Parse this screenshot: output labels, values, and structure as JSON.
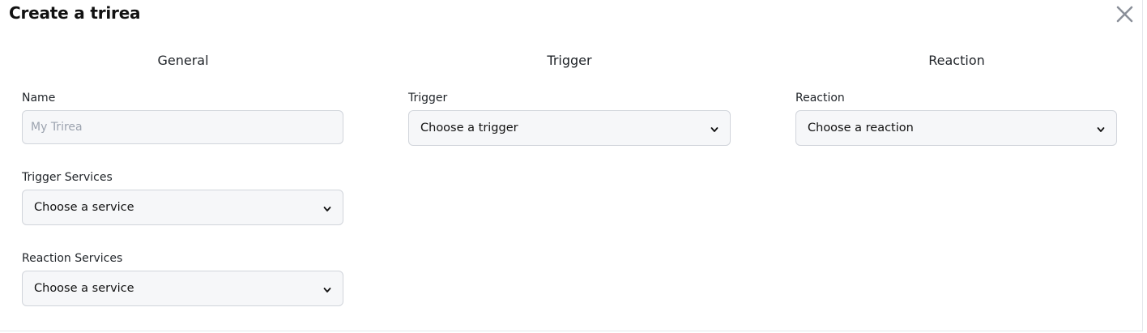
{
  "modal": {
    "title": "Create a trirea",
    "close_icon": "close-x-icon"
  },
  "general": {
    "heading": "General",
    "name_label": "Name",
    "name_placeholder": "My Trirea",
    "trigger_services_label": "Trigger Services",
    "trigger_services_value": "Choose a service",
    "reaction_services_label": "Reaction Services",
    "reaction_services_value": "Choose a service"
  },
  "trigger": {
    "heading": "Trigger",
    "trigger_label": "Trigger",
    "trigger_value": "Choose a trigger"
  },
  "reaction": {
    "heading": "Reaction",
    "reaction_label": "Reaction",
    "reaction_value": "Choose a reaction"
  },
  "icons": {
    "dropdown": "chevron-down-icon"
  }
}
